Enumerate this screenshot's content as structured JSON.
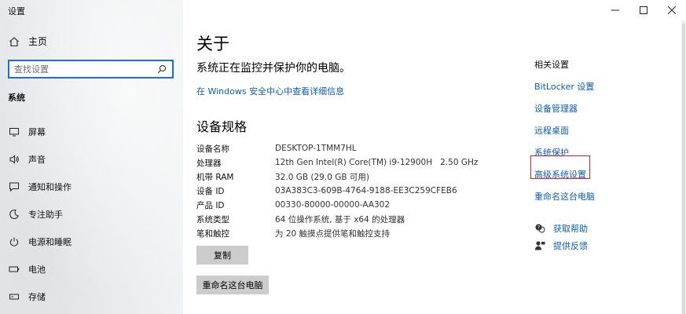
{
  "window": {
    "title": "设置"
  },
  "sidebar": {
    "home_label": "主页",
    "search_placeholder": "查找设置",
    "section": "系统",
    "items": [
      {
        "label": "屏幕",
        "icon": "monitor-icon"
      },
      {
        "label": "声音",
        "icon": "speaker-icon"
      },
      {
        "label": "通知和操作",
        "icon": "notification-icon"
      },
      {
        "label": "专注助手",
        "icon": "moon-icon"
      },
      {
        "label": "电源和睡眠",
        "icon": "power-icon"
      },
      {
        "label": "电池",
        "icon": "battery-icon"
      },
      {
        "label": "存储",
        "icon": "storage-icon"
      }
    ]
  },
  "main": {
    "title": "关于",
    "status": "系统正在监控并保护你的电脑。",
    "security_link": "在 Windows 安全中心中查看详细信息",
    "spec_title": "设备规格",
    "specs": [
      {
        "key": "设备名称",
        "value": "DESKTOP-1TMM7HL"
      },
      {
        "key": "处理器",
        "value": "12th Gen Intel(R) Core(TM) i9-12900H   2.50 GHz"
      },
      {
        "key": "机带 RAM",
        "value": "32.0 GB (29.0 GB 可用)"
      },
      {
        "key": "设备 ID",
        "value": "03A383C3-609B-4764-9188-EE3C259CFEB6"
      },
      {
        "key": "产品 ID",
        "value": "00330-80000-00000-AA302"
      },
      {
        "key": "系统类型",
        "value": "64 位操作系统, 基于 x64 的处理器"
      },
      {
        "key": "笔和触控",
        "value": "为 20 触摸点提供笔和触控支持"
      }
    ],
    "copy_button": "复制",
    "rename_button": "重命名这台电脑"
  },
  "related": {
    "title": "相关设置",
    "links": [
      "BitLocker 设置",
      "设备管理器",
      "远程桌面",
      "系统保护",
      "高级系统设置",
      "重命名这台电脑"
    ]
  },
  "help": {
    "get_help": "获取帮助",
    "feedback": "提供反馈"
  },
  "colors": {
    "accent": "#0a5eb8",
    "highlight_border": "#e02020",
    "button_bg": "#cccccc"
  }
}
